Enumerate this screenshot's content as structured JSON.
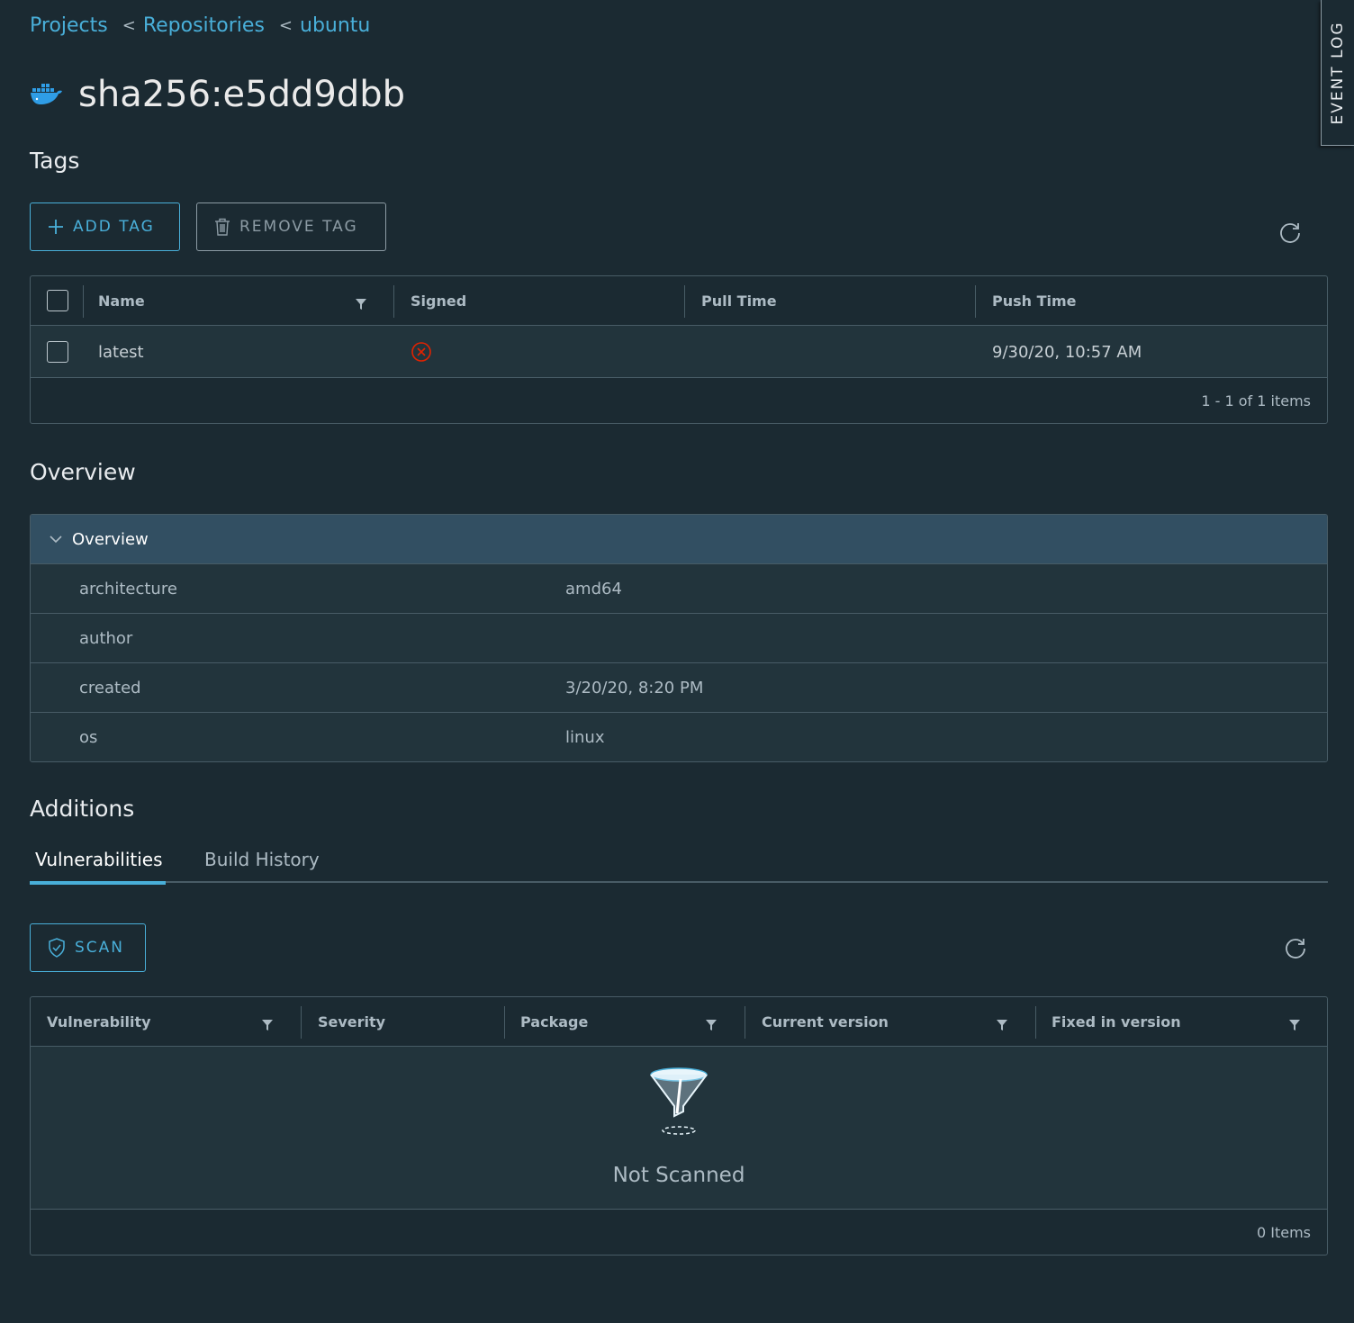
{
  "breadcrumb": {
    "projects": "Projects",
    "repositories": "Repositories",
    "repo": "ubuntu",
    "separator": "<"
  },
  "page": {
    "title": "sha256:e5dd9dbb",
    "icon": "docker-whale-icon"
  },
  "tags_section": {
    "heading": "Tags",
    "add_tag_label": "ADD TAG",
    "remove_tag_label": "REMOVE TAG",
    "columns": [
      "Name",
      "Signed",
      "Pull Time",
      "Push Time"
    ],
    "rows": [
      {
        "name": "latest",
        "signed": "not-signed",
        "pull_time": "",
        "push_time": "9/30/20, 10:57 AM"
      }
    ],
    "footer": "1 - 1 of 1 items"
  },
  "overview_section": {
    "heading": "Overview",
    "stack_title": "Overview",
    "rows": [
      {
        "key": "architecture",
        "value": "amd64"
      },
      {
        "key": "author",
        "value": ""
      },
      {
        "key": "created",
        "value": "3/20/20, 8:20 PM"
      },
      {
        "key": "os",
        "value": "linux"
      }
    ]
  },
  "additions_section": {
    "heading": "Additions",
    "tabs": [
      {
        "label": "Vulnerabilities",
        "active": true
      },
      {
        "label": "Build History",
        "active": false
      }
    ],
    "scan_label": "SCAN",
    "columns": [
      "Vulnerability",
      "Severity",
      "Package",
      "Current version",
      "Fixed in version"
    ],
    "empty_message": "Not Scanned",
    "footer": "0 Items"
  },
  "event_log": {
    "label": "EVENT LOG"
  },
  "colors": {
    "accent": "#49afd9",
    "background": "#1b2a32",
    "row": "#22343c",
    "stack_header": "#324f62",
    "error": "#e12200"
  }
}
